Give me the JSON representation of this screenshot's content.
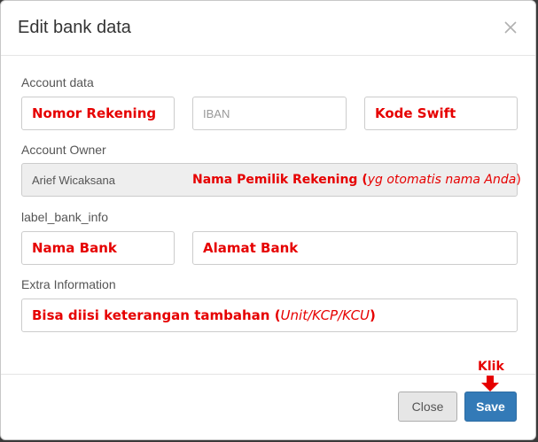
{
  "modal": {
    "title": "Edit bank data"
  },
  "sections": {
    "account_data": "Account data",
    "account_owner": "Account Owner",
    "bank_info": "label_bank_info",
    "extra_info": "Extra Information"
  },
  "fields": {
    "account_number": "Nomor Rekening",
    "iban_placeholder": "IBAN",
    "swift_code": "Kode Swift",
    "owner_name": "Arief Wicaksana",
    "bank_name": "Nama Bank",
    "bank_address": "Alamat Bank",
    "extra_main": "Bisa diisi keterangan tambahan (",
    "extra_italic": "Unit/KCP/KCU",
    "extra_end": ")"
  },
  "annotations": {
    "owner_main": "Nama Pemilik Rekening (",
    "owner_italic": "yg otomatis nama Anda",
    "owner_end": ")",
    "click": "Klik"
  },
  "buttons": {
    "close": "Close",
    "save": "Save"
  },
  "colors": {
    "annotation": "#e60000",
    "primary": "#337ab7"
  }
}
